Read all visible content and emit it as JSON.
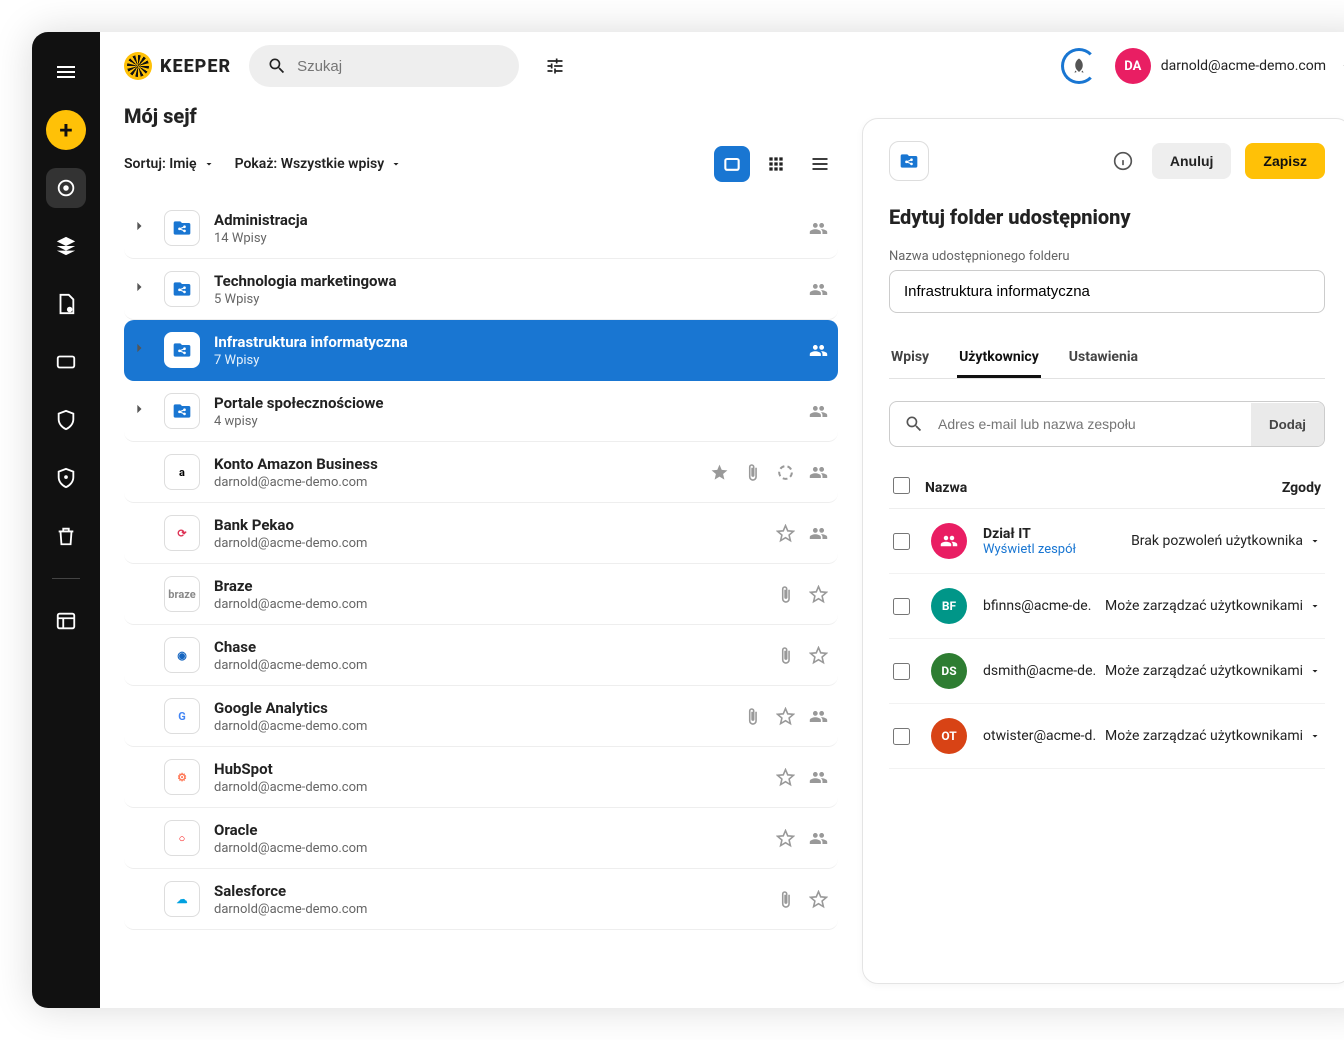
{
  "brand": "KEEPER",
  "search_placeholder": "Szukaj",
  "user": {
    "initials": "DA",
    "email": "darnold@acme-demo.com"
  },
  "vault": {
    "title": "Mój sejf",
    "sort_label": "Sortuj: Imię",
    "show_label": "Pokaż: Wszystkie wpisy"
  },
  "folders": [
    {
      "name": "Administracja",
      "sub": "14 Wpisy",
      "selected": false
    },
    {
      "name": "Technologia marketingowa",
      "sub": "5 Wpisy",
      "selected": false
    },
    {
      "name": "Infrastruktura informatyczna",
      "sub": "7 Wpisy",
      "selected": true
    },
    {
      "name": "Portale społecznościowe",
      "sub": "4 wpisy",
      "selected": false
    }
  ],
  "entries": [
    {
      "name": "Konto Amazon Business",
      "sub": "darnold@acme-demo.com",
      "iconText": "a",
      "iconColor": "#000",
      "icons": [
        "star-filled",
        "attach",
        "ring",
        "share"
      ]
    },
    {
      "name": "Bank Pekao",
      "sub": "darnold@acme-demo.com",
      "iconText": "⟳",
      "iconColor": "#d35",
      "icons": [
        "star",
        "share"
      ]
    },
    {
      "name": "Braze",
      "sub": "darnold@acme-demo.com",
      "iconText": "braze",
      "iconColor": "#888",
      "icons": [
        "attach",
        "star"
      ]
    },
    {
      "name": "Chase",
      "sub": "darnold@acme-demo.com",
      "iconText": "◉",
      "iconColor": "#1565C0",
      "icons": [
        "attach",
        "star"
      ]
    },
    {
      "name": "Google Analytics",
      "sub": "darnold@acme-demo.com",
      "iconText": "G",
      "iconColor": "#4285F4",
      "icons": [
        "attach",
        "star",
        "share"
      ]
    },
    {
      "name": "HubSpot",
      "sub": "darnold@acme-demo.com",
      "iconText": "⚙",
      "iconColor": "#FF7A59",
      "icons": [
        "star",
        "share"
      ]
    },
    {
      "name": "Oracle",
      "sub": "darnold@acme-demo.com",
      "iconText": "○",
      "iconColor": "#F80000",
      "icons": [
        "star",
        "share"
      ]
    },
    {
      "name": "Salesforce",
      "sub": "darnold@acme-demo.com",
      "iconText": "☁",
      "iconColor": "#00A1E0",
      "icons": [
        "attach",
        "star"
      ]
    }
  ],
  "panel": {
    "heading": "Edytuj folder udostępniony",
    "cancel": "Anuluj",
    "save": "Zapisz",
    "name_label": "Nazwa udostępnionego folderu",
    "name_value": "Infrastruktura informatyczna",
    "tabs": {
      "entries": "Wpisy",
      "users": "Użytkownicy",
      "settings": "Ustawienia"
    },
    "search_placeholder": "Adres e-mail lub nazwa zespołu",
    "add": "Dodaj",
    "col_name": "Nazwa",
    "col_perm": "Zgody"
  },
  "members": [
    {
      "initials": "👥",
      "bg": "#E91E63",
      "name": "Dział IT",
      "link": "Wyświetl zespół",
      "perm": "Brak pozwoleń użytkownika",
      "team": true
    },
    {
      "initials": "BF",
      "bg": "#009688",
      "email": "bfinns@acme-de.",
      "perm": "Może zarządzać użytkownikami"
    },
    {
      "initials": "DS",
      "bg": "#2E7D32",
      "email": "dsmith@acme-de.",
      "perm": "Może zarządzać użytkownikami"
    },
    {
      "initials": "OT",
      "bg": "#D84315",
      "email": "otwister@acme-d.",
      "perm": "Może zarządzać użytkownikami"
    }
  ]
}
